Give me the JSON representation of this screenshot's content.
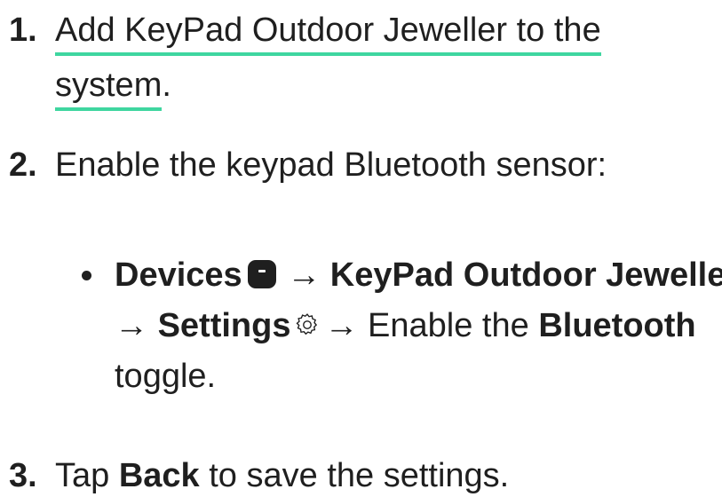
{
  "step1": {
    "number": "1.",
    "link_line1": "Add KeyPad Outdoor Jeweller to the",
    "link_line2": "system",
    "end": "."
  },
  "step2": {
    "number": "2.",
    "text": "Enable the keypad Bluetooth sensor:",
    "sub": {
      "devices": "Devices",
      "arrow": "→",
      "device_name": "KeyPad Outdoor Jeweller",
      "settings": "Settings",
      "enable_the": "Enable the",
      "bluetooth": "Bluetooth",
      "toggle": "toggle."
    }
  },
  "step3": {
    "number": "3.",
    "tap": "Tap",
    "back": "Back",
    "rest": "to save the settings."
  },
  "icons": {
    "devices": "devices-icon",
    "settings": "gear-icon"
  },
  "colors": {
    "link_underline": "#3fd6a0",
    "text": "#1f1f1f"
  }
}
